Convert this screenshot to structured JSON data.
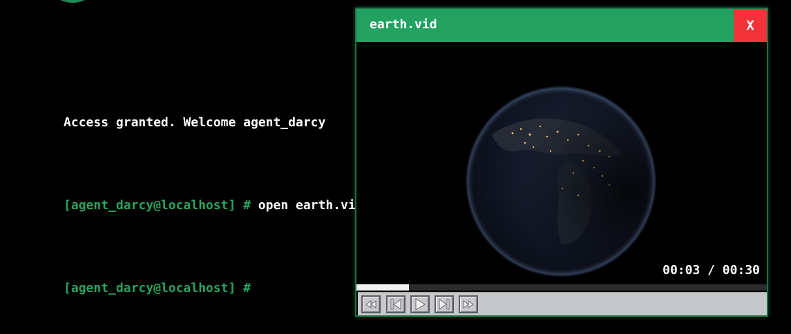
{
  "terminal": {
    "lines": [
      {
        "prompt": "",
        "text": "Access granted. Welcome agent_darcy"
      },
      {
        "prompt": "[agent_darcy@localhost] #",
        "text": " open earth.vid"
      },
      {
        "prompt": "[agent_darcy@localhost] #",
        "text": ""
      }
    ]
  },
  "video_window": {
    "title": "earth.vid",
    "close_label": "X",
    "timecode": "00:03 / 00:30",
    "progress_fraction": 0.1,
    "controls": [
      "rewind-icon",
      "skip-back-icon",
      "play-icon",
      "skip-forward-icon",
      "fast-forward-icon"
    ]
  },
  "colors": {
    "accent": "#22a161",
    "prompt": "#2aa35f",
    "close": "#f2333a"
  }
}
